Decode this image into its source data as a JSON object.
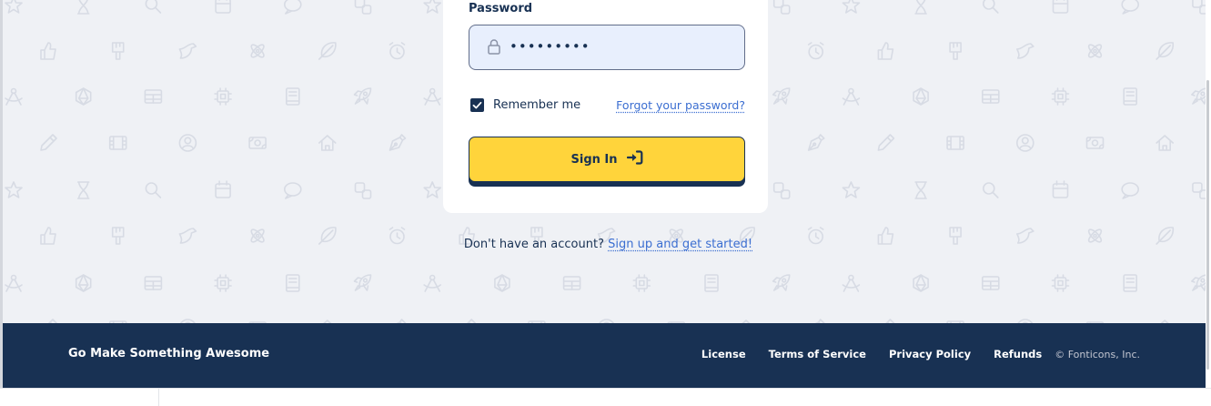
{
  "login": {
    "password_label": "Password",
    "password_value": "•••••••••",
    "remember_label": "Remember me",
    "remember_checked": true,
    "forgot_link": "Forgot your password?",
    "signin_label": "Sign In"
  },
  "signup": {
    "prompt": "Don't have an account?",
    "link": "Sign up and get started!"
  },
  "footer": {
    "brand": "Go Make Something Awesome",
    "links": [
      "License",
      "Terms of Service",
      "Privacy Policy",
      "Refunds"
    ],
    "copyright": "© Fonticons, Inc."
  },
  "colors": {
    "brand_navy": "#183153",
    "button_yellow": "#ffd43b",
    "link_blue": "#3b6ed1",
    "page_bg": "#eff1f5",
    "input_bg": "#e8effd"
  },
  "background_icons": [
    "star-icon",
    "hourglass-icon",
    "magnifying-glass-icon",
    "calendar-icon",
    "comment-icon",
    "dice-icon",
    "thumbs-up-icon",
    "paintbrush-icon",
    "dove-icon",
    "atom-icon",
    "feather-icon",
    "alarm-clock-icon",
    "compass-drafting-icon",
    "dice-d20-icon",
    "table-icon",
    "microchip-icon",
    "book-icon",
    "rocket-icon",
    "pencil-icon",
    "film-icon",
    "user-circle-icon",
    "money-bill-icon",
    "house-icon",
    "pen-nib-icon"
  ]
}
